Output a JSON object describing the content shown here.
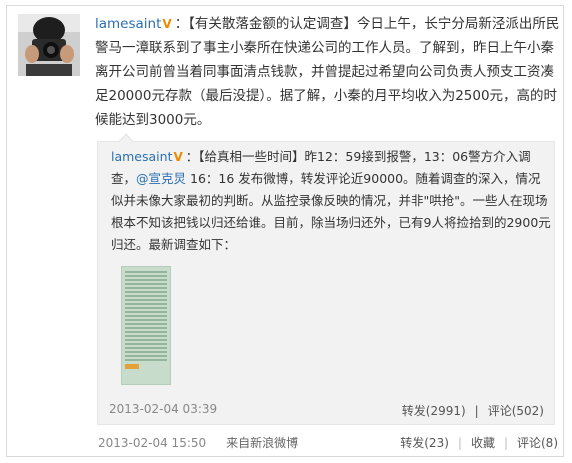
{
  "post": {
    "username": "lamesaint",
    "badge": "V",
    "text": "：【有关散落金额的认定调查】今日上午，长宁分局新泾派出所民警马一漳联系到了事主小秦所在快递公司的工作人员。了解到，昨日上午小秦离开公司前曾当着同事面清点钱款，并曾提起过希望向公司负责人预支工资凑足20000元存款（最后没提）。据了解，小秦的月平均收入为2500元，高的时候能达到3000元。",
    "time": "2013-02-04 15:50",
    "source": "来自新浪微博",
    "actions": {
      "repost": "转发(23)",
      "favorite": "收藏",
      "comment": "评论(8)"
    }
  },
  "repost": {
    "username": "lamesaint",
    "badge": "V",
    "text_before_mention": "：【给真相一些时间】昨12：59接到报警，13：06警方介入调查，",
    "mention": "@宣克炅",
    "text_after_mention": " 16：16 发布微博，转发评论近90000。随着调查的深入，情况似并未像大家最初的判断。从监控录像反映的情况，并非\"哄抢\"。一些人在现场根本不知该把钱以归还给谁。目前，除当场归还外，已有9人将捡拾到的2900元归还。最新调查如下：",
    "time": "2013-02-04 03:39",
    "actions": {
      "repost": "转发(2991)",
      "comment": "评论(502)"
    }
  },
  "icons": {
    "avatar": "avatar-photographer",
    "verified": "verified-v-badge",
    "thumbnail": "image-thumbnail"
  },
  "colors": {
    "link": "#2a6fb3",
    "badge": "#f08a00",
    "repost_bg": "#f2f2f2",
    "meta": "#888888"
  }
}
